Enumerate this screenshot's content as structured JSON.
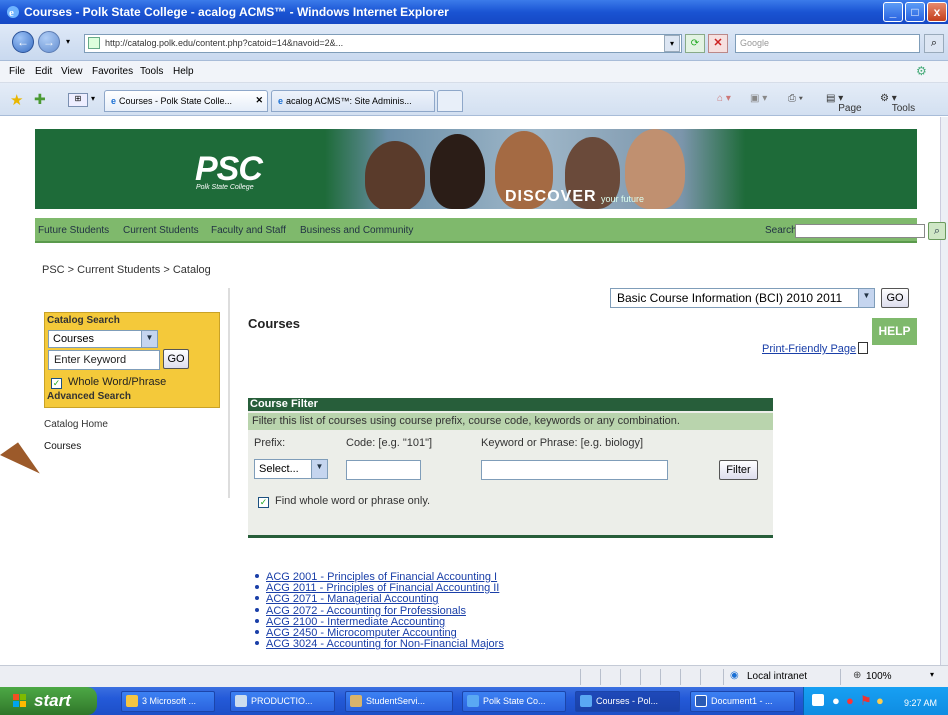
{
  "window": {
    "title": "Courses - Polk State College - acalog ACMS™ - Windows Internet Explorer",
    "url": "http://catalog.polk.edu/content.php?catoid=14&navoid=2&...",
    "search_placeholder": "Google"
  },
  "menu": [
    "File",
    "Edit",
    "View",
    "Favorites",
    "Tools",
    "Help"
  ],
  "tabs": [
    {
      "label": "Courses - Polk State Colle..."
    },
    {
      "label": "acalog ACMS™: Site Adminis..."
    }
  ],
  "toolbar_right": {
    "page": "Page",
    "tools": "Tools"
  },
  "banner": {
    "logo": "PSC",
    "logo_sub": "Polk State College",
    "discover": "DISCOVER",
    "your_future": "your future"
  },
  "nav": {
    "items": [
      "Future Students",
      "Current Students",
      "Faculty and Staff",
      "Business and Community"
    ],
    "search_label": "Search"
  },
  "breadcrumb": "PSC > Current Students > Catalog",
  "sidebar": {
    "catalog_search_title": "Catalog Search",
    "search_type": "Courses",
    "keyword_placeholder": "Enter Keyword",
    "go": "GO",
    "whole_word": "Whole Word/Phrase",
    "advanced_search": "Advanced Search",
    "catalog_home": "Catalog Home",
    "courses": "Courses"
  },
  "main": {
    "catalog_select": "Basic Course Information (BCI) 2010 2011",
    "go": "GO",
    "title": "Courses",
    "help": "HELP",
    "print_friendly": "Print-Friendly Page"
  },
  "filter": {
    "heading": "Course Filter",
    "description": "Filter this list of courses using course prefix, course code, keywords or any combination.",
    "prefix_label": "Prefix:",
    "code_label": "Code: [e.g. \"101\"]",
    "keyword_label": "Keyword or Phrase: [e.g. biology]",
    "prefix_value": "Select...",
    "filter_button": "Filter",
    "find_whole": "Find whole word or phrase only."
  },
  "courses": [
    "ACG 2001 - Principles of Financial Accounting I",
    "ACG 2011 - Principles of Financial Accounting II",
    "ACG 2071 - Managerial Accounting",
    "ACG 2072 - Accounting for Professionals",
    "ACG 2100 - Intermediate Accounting",
    "ACG 2450 - Microcomputer Accounting",
    "ACG 3024 - Accounting for Non-Financial Majors"
  ],
  "status": {
    "zone": "Local intranet",
    "zoom": "100%"
  },
  "taskbar": {
    "start": "start",
    "buttons": [
      "3 Microsoft ...",
      "PRODUCTIO...",
      "StudentServi...",
      "Polk State Co...",
      "Courses - Pol...",
      "Document1 - ..."
    ],
    "clock": "9:27 AM"
  },
  "colors": {
    "psc_green": "#1e6b39",
    "nav_green": "#7fb96c",
    "catalog_yellow": "#f4c93a",
    "link_blue": "#1a3fa8",
    "xp_blue": "#245ad9"
  }
}
